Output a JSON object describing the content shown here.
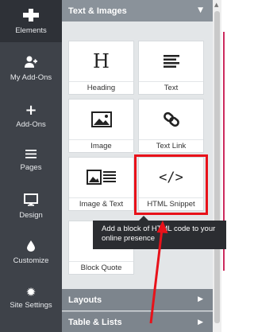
{
  "sidebar": {
    "items": [
      {
        "label": "Elements",
        "icon": "elements-icon",
        "active": true
      },
      {
        "label": "My Add-Ons",
        "icon": "user-plus-icon"
      },
      {
        "label": "Add-Ons",
        "icon": "plus-icon"
      },
      {
        "label": "Pages",
        "icon": "hamburger-icon"
      },
      {
        "label": "Design",
        "icon": "monitor-icon"
      },
      {
        "label": "Customize",
        "icon": "drop-icon"
      },
      {
        "label": "Site Settings",
        "icon": "gear-icon"
      }
    ]
  },
  "panel": {
    "section_title": "Text & Images",
    "tiles": [
      {
        "label": "Heading",
        "icon": "heading-icon"
      },
      {
        "label": "Text",
        "icon": "text-lines-icon"
      },
      {
        "label": "Image",
        "icon": "image-icon"
      },
      {
        "label": "Text Link",
        "icon": "link-icon"
      },
      {
        "label": "Image & Text",
        "icon": "image-text-icon"
      },
      {
        "label": "HTML Snippet",
        "icon": "code-icon"
      },
      {
        "label": "Block Quote",
        "icon": "quote-icon"
      }
    ],
    "collapsed_sections": [
      {
        "label": "Layouts"
      },
      {
        "label": "Table & Lists"
      }
    ]
  },
  "tooltip": {
    "text": "Add a block of HTML code to your online presence"
  },
  "colors": {
    "sidebar_bg": "#3e4249",
    "panel_bg": "#e3e6e8",
    "section_header_bg": "#8a929a",
    "annotation_red": "#e8121a",
    "tooltip_bg": "#2b2d31"
  }
}
